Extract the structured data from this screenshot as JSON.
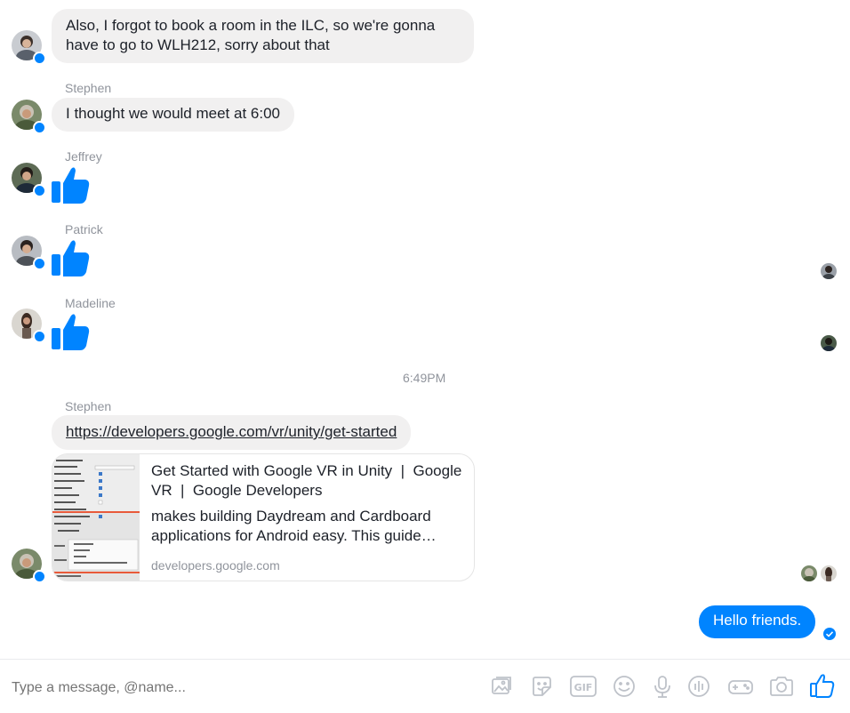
{
  "messages": [
    {
      "text": "Also, I forgot to book a room in the ILC, so we're gonna have to go to WLH212, sorry about that"
    },
    {
      "sender": "Stephen",
      "text": "I thought we would meet at 6:00"
    },
    {
      "sender": "Jeffrey",
      "like": true
    },
    {
      "sender": "Patrick",
      "like": true
    },
    {
      "sender": "Madeline",
      "like": true
    }
  ],
  "timestamp": "6:49PM",
  "link_message": {
    "sender": "Stephen",
    "url": "https://developers.google.com/vr/unity/get-started",
    "card": {
      "title": "Get Started with Google VR in Unity  |  Google VR  |  Google Developers",
      "description": "makes building Daydream and Cardboard applications for Android easy. This guide…",
      "domain": "developers.google.com"
    }
  },
  "sent_message": {
    "text": "Hello friends."
  },
  "composer": {
    "placeholder": "Type a message, @name...",
    "tools": [
      "photo-icon",
      "sticker-icon",
      "gif-icon",
      "emoji-icon",
      "microphone-icon",
      "voice-clip-icon",
      "game-controller-icon",
      "camera-icon",
      "like-icon"
    ]
  },
  "colors": {
    "accent": "#0084ff",
    "bubble_gray": "#f1f0f0",
    "meta_text": "#90949c"
  }
}
